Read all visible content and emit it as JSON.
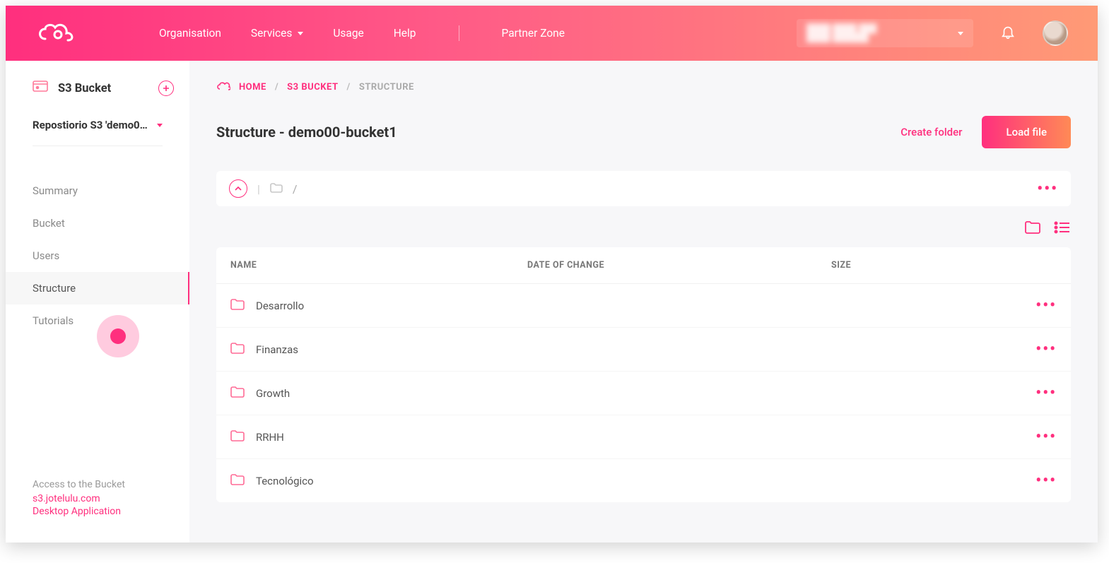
{
  "nav": {
    "organisation": "Organisation",
    "services": "Services",
    "usage": "Usage",
    "help": "Help",
    "partner_zone": "Partner Zone"
  },
  "sidebar": {
    "title": "S3 Bucket",
    "repo_label": "Repostiorio S3 'demo00-b…",
    "items": [
      {
        "label": "Summary"
      },
      {
        "label": "Bucket"
      },
      {
        "label": "Users"
      },
      {
        "label": "Structure"
      },
      {
        "label": "Tutorials"
      }
    ],
    "footer": {
      "access_label": "Access to the Bucket",
      "url": "s3.jotelulu.com",
      "desktop": "Desktop Application"
    }
  },
  "breadcrumb": {
    "home": "HOME",
    "s3": "S3 BUCKET",
    "current": "STRUCTURE"
  },
  "page": {
    "title": "Structure - demo00-bucket1",
    "create_folder": "Create folder",
    "load_file": "Load file"
  },
  "path": {
    "root": "/"
  },
  "table": {
    "headers": {
      "name": "NAME",
      "date": "DATE OF CHANGE",
      "size": "SIZE"
    },
    "rows": [
      {
        "name": "Desarrollo"
      },
      {
        "name": "Finanzas"
      },
      {
        "name": "Growth"
      },
      {
        "name": "RRHH"
      },
      {
        "name": "Tecnológico"
      }
    ]
  }
}
